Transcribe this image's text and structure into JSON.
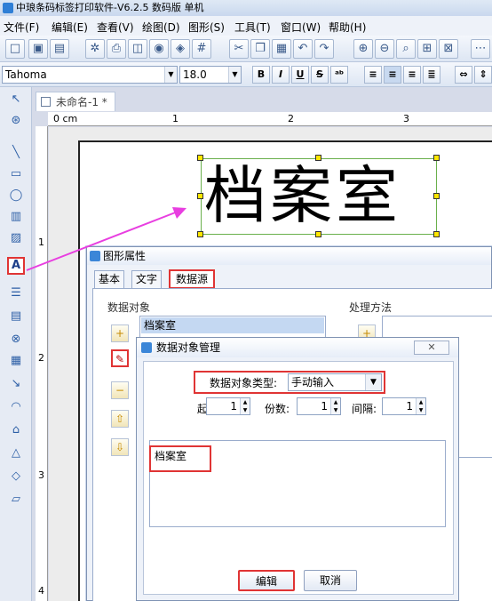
{
  "window": {
    "title": "中琅条码标签打印软件-V6.2.5 数码版 单机"
  },
  "menu": [
    "文件(F)",
    "编辑(E)",
    "查看(V)",
    "绘图(D)",
    "图形(S)",
    "工具(T)",
    "窗口(W)",
    "帮助(H)"
  ],
  "toolbar": {
    "font_name": "Tahoma",
    "font_size": "18.0",
    "bold": "B",
    "italic": "I",
    "underline": "U",
    "strike": "S"
  },
  "document": {
    "tab_title": "未命名-1 *",
    "label_text": "档案室"
  },
  "ruler": {
    "unit": "0 cm",
    "h_ticks": [
      "1",
      "2",
      "3"
    ],
    "v_ticks": [
      "1",
      "2",
      "3",
      "4"
    ]
  },
  "shape_props_dialog": {
    "title": "图形属性",
    "tabs": [
      "基本",
      "文字",
      "数据源"
    ],
    "data_objects_label": "数据对象",
    "data_objects": [
      "档案室"
    ],
    "processing_label": "处理方法"
  },
  "data_object_dialog": {
    "title": "数据对象管理",
    "type_label": "数据对象类型:",
    "type_value": "手动输入",
    "start_label": "起始:",
    "start_value": "1",
    "copies_label": "份数:",
    "copies_value": "1",
    "interval_label": "间隔:",
    "interval_value": "1",
    "content": "档案室",
    "edit_button": "编辑",
    "cancel_button": "取消"
  },
  "colors": {
    "highlight": "#e03434",
    "arrow": "#e83ee0",
    "selection": "#6ab04c",
    "handle": "#ffe600"
  }
}
